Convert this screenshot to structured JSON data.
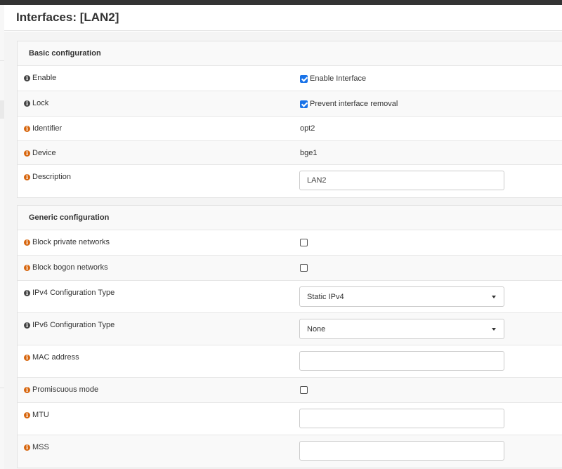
{
  "title": "Interfaces: [LAN2]",
  "basic": {
    "header": "Basic configuration",
    "enable": {
      "label": "Enable",
      "checkbox_label": "Enable Interface",
      "checked": true
    },
    "lock": {
      "label": "Lock",
      "checkbox_label": "Prevent interface removal",
      "checked": true
    },
    "identifier": {
      "label": "Identifier",
      "value": "opt2"
    },
    "device": {
      "label": "Device",
      "value": "bge1"
    },
    "description": {
      "label": "Description",
      "value": "LAN2"
    }
  },
  "generic": {
    "header": "Generic configuration",
    "block_private": {
      "label": "Block private networks",
      "checked": false
    },
    "block_bogon": {
      "label": "Block bogon networks",
      "checked": false
    },
    "ipv4_type": {
      "label": "IPv4 Configuration Type",
      "value": "Static IPv4"
    },
    "ipv6_type": {
      "label": "IPv6 Configuration Type",
      "value": "None"
    },
    "mac": {
      "label": "MAC address",
      "value": ""
    },
    "promisc": {
      "label": "Promiscuous mode",
      "checked": false
    },
    "mtu": {
      "label": "MTU",
      "value": ""
    },
    "mss": {
      "label": "MSS",
      "value": ""
    }
  },
  "icons": {
    "info_icon": "i",
    "info_dark_color": "#444444",
    "info_orange_color": "#d7660e",
    "accent": "#1a73e8"
  }
}
